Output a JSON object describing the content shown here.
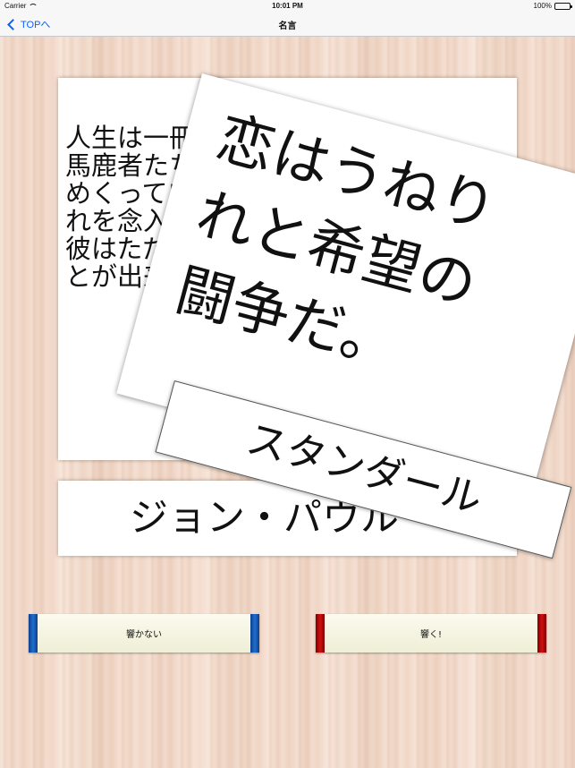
{
  "status_bar": {
    "carrier": "Carrier",
    "time": "10:01 PM",
    "battery": "100%",
    "battery_level": 1.0
  },
  "nav_bar": {
    "back_label": "TOPへ",
    "title": "名言"
  },
  "quote_card": {
    "text": "人生は一冊の\n馬鹿者たちは\nめくっている\nれを念入りに\n彼はただ一度\nとが出来ない"
  },
  "author_card": {
    "text": "ジョン・パウル"
  },
  "tilted_quote": {
    "text": "恋はうねり\nれと希望の\n闘争だ。"
  },
  "tilted_author": {
    "text": "スタンダール"
  },
  "buttons": {
    "left_label": "響かない",
    "right_label": "響く!"
  },
  "colors": {
    "accent_blue": "#1f6fd0",
    "accent_red": "#d01010",
    "back_link": "#0a60ff"
  }
}
